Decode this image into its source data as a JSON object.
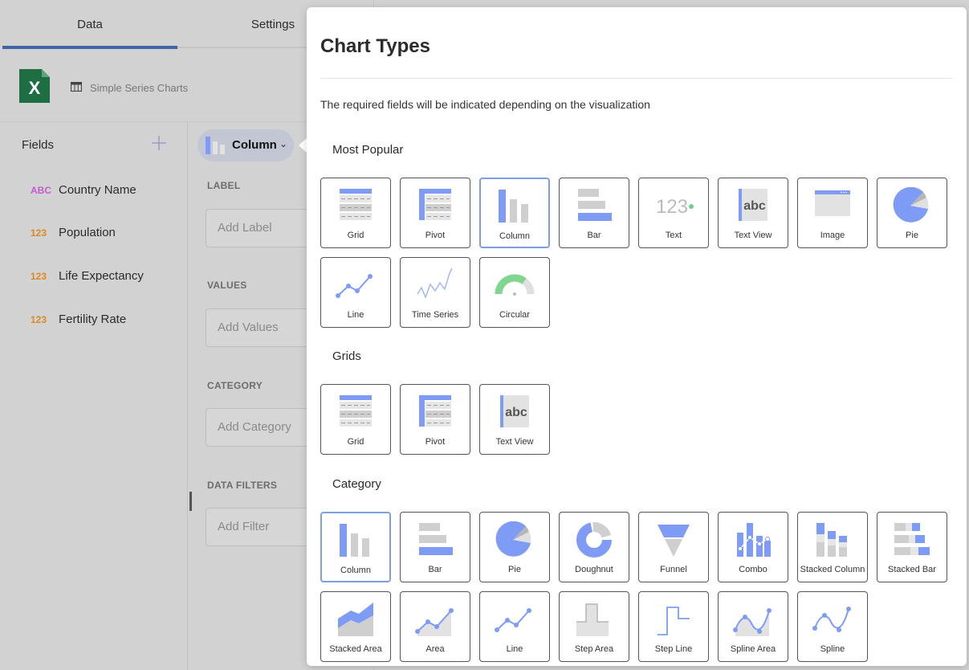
{
  "editor": {
    "tabs": {
      "data": "Data",
      "settings": "Settings"
    },
    "source": {
      "name": "Simple Series Charts",
      "icon": "excel-icon"
    },
    "fields": {
      "title": "Fields",
      "items": [
        {
          "type": "ABC",
          "name": "Country Name"
        },
        {
          "type": "123",
          "name": "Population"
        },
        {
          "type": "123",
          "name": "Life Expectancy"
        },
        {
          "type": "123",
          "name": "Fertility Rate"
        }
      ]
    },
    "chart_selector": {
      "label": "Column"
    },
    "shelves": {
      "label": {
        "title": "LABEL",
        "placeholder": "Add Label"
      },
      "values": {
        "title": "VALUES",
        "placeholder": "Add Values"
      },
      "category": {
        "title": "CATEGORY",
        "placeholder": "Add Category"
      },
      "filters": {
        "title": "DATA FILTERS",
        "placeholder": "Add Filter"
      }
    }
  },
  "modal": {
    "title": "Chart Types",
    "description": "The required fields will be indicated depending on the visualization",
    "sections": [
      {
        "title": "Most Popular",
        "items": [
          {
            "label": "Grid",
            "icon": "grid"
          },
          {
            "label": "Pivot",
            "icon": "pivot"
          },
          {
            "label": "Column",
            "icon": "column",
            "selected": true
          },
          {
            "label": "Bar",
            "icon": "bar"
          },
          {
            "label": "Text",
            "icon": "text"
          },
          {
            "label": "Text View",
            "icon": "textview"
          },
          {
            "label": "Image",
            "icon": "image"
          },
          {
            "label": "Pie",
            "icon": "pie"
          },
          {
            "label": "Line",
            "icon": "line"
          },
          {
            "label": "Time Series",
            "icon": "timeseries"
          },
          {
            "label": "Circular",
            "icon": "circular"
          }
        ]
      },
      {
        "title": "Grids",
        "items": [
          {
            "label": "Grid",
            "icon": "grid"
          },
          {
            "label": "Pivot",
            "icon": "pivot"
          },
          {
            "label": "Text View",
            "icon": "textview"
          }
        ]
      },
      {
        "title": "Category",
        "items": [
          {
            "label": "Column",
            "icon": "column",
            "selected": true
          },
          {
            "label": "Bar",
            "icon": "bar"
          },
          {
            "label": "Pie",
            "icon": "pie"
          },
          {
            "label": "Doughnut",
            "icon": "doughnut"
          },
          {
            "label": "Funnel",
            "icon": "funnel"
          },
          {
            "label": "Combo",
            "icon": "combo"
          },
          {
            "label": "Stacked Column",
            "icon": "stackedcolumn"
          },
          {
            "label": "Stacked Bar",
            "icon": "stackedbar"
          },
          {
            "label": "Stacked Area",
            "icon": "stackedarea"
          },
          {
            "label": "Area",
            "icon": "area"
          },
          {
            "label": "Line",
            "icon": "line"
          },
          {
            "label": "Step Area",
            "icon": "steparea"
          },
          {
            "label": "Step Line",
            "icon": "stepline"
          },
          {
            "label": "Spline Area",
            "icon": "splinearea"
          },
          {
            "label": "Spline",
            "icon": "spline"
          }
        ]
      }
    ]
  },
  "colors": {
    "accent": "#4163a8",
    "icon_blue": "#7e9cf5",
    "icon_gray": "#cfcfcf",
    "selected_border": "#7d9fdf",
    "type_text": "#c45bd0",
    "type_number": "#d98a26"
  }
}
